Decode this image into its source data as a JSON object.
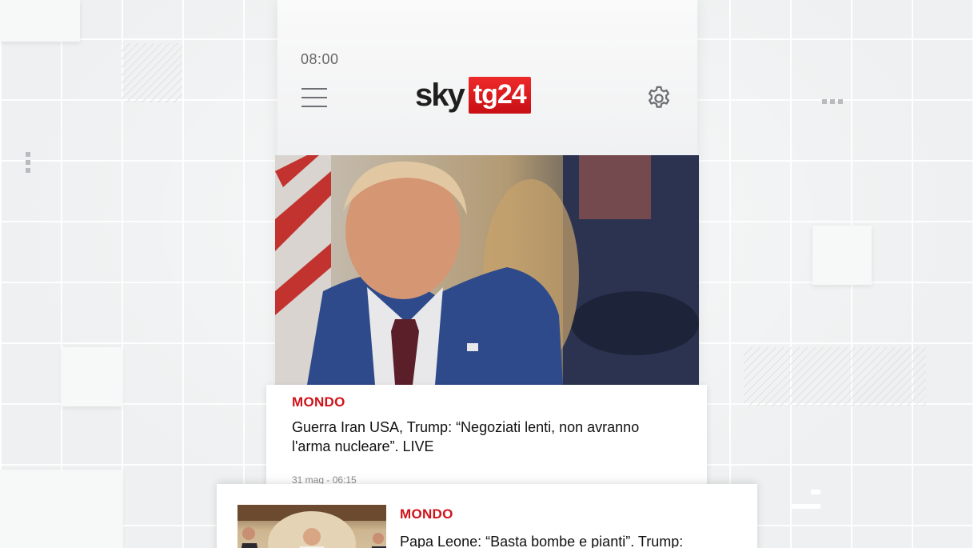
{
  "status_bar": {
    "time": "08:00"
  },
  "header": {
    "logo_sky": "sky",
    "logo_tg": "tg24"
  },
  "icons": {
    "menu": "hamburger-menu-icon",
    "settings": "gear-icon"
  },
  "articles": [
    {
      "section": "MONDO",
      "headline": "Guerra Iran USA, Trump: “Negoziati lenti, non avranno l'arma nucleare”. LIVE",
      "meta": "31 mag - 06:15"
    },
    {
      "section": "MONDO",
      "headline": "Papa Leone: “Basta bombe e pianti”. Trump:"
    }
  ],
  "colors": {
    "brand_red": "#d0121a",
    "text": "#111111",
    "meta": "#8a8c8e"
  }
}
